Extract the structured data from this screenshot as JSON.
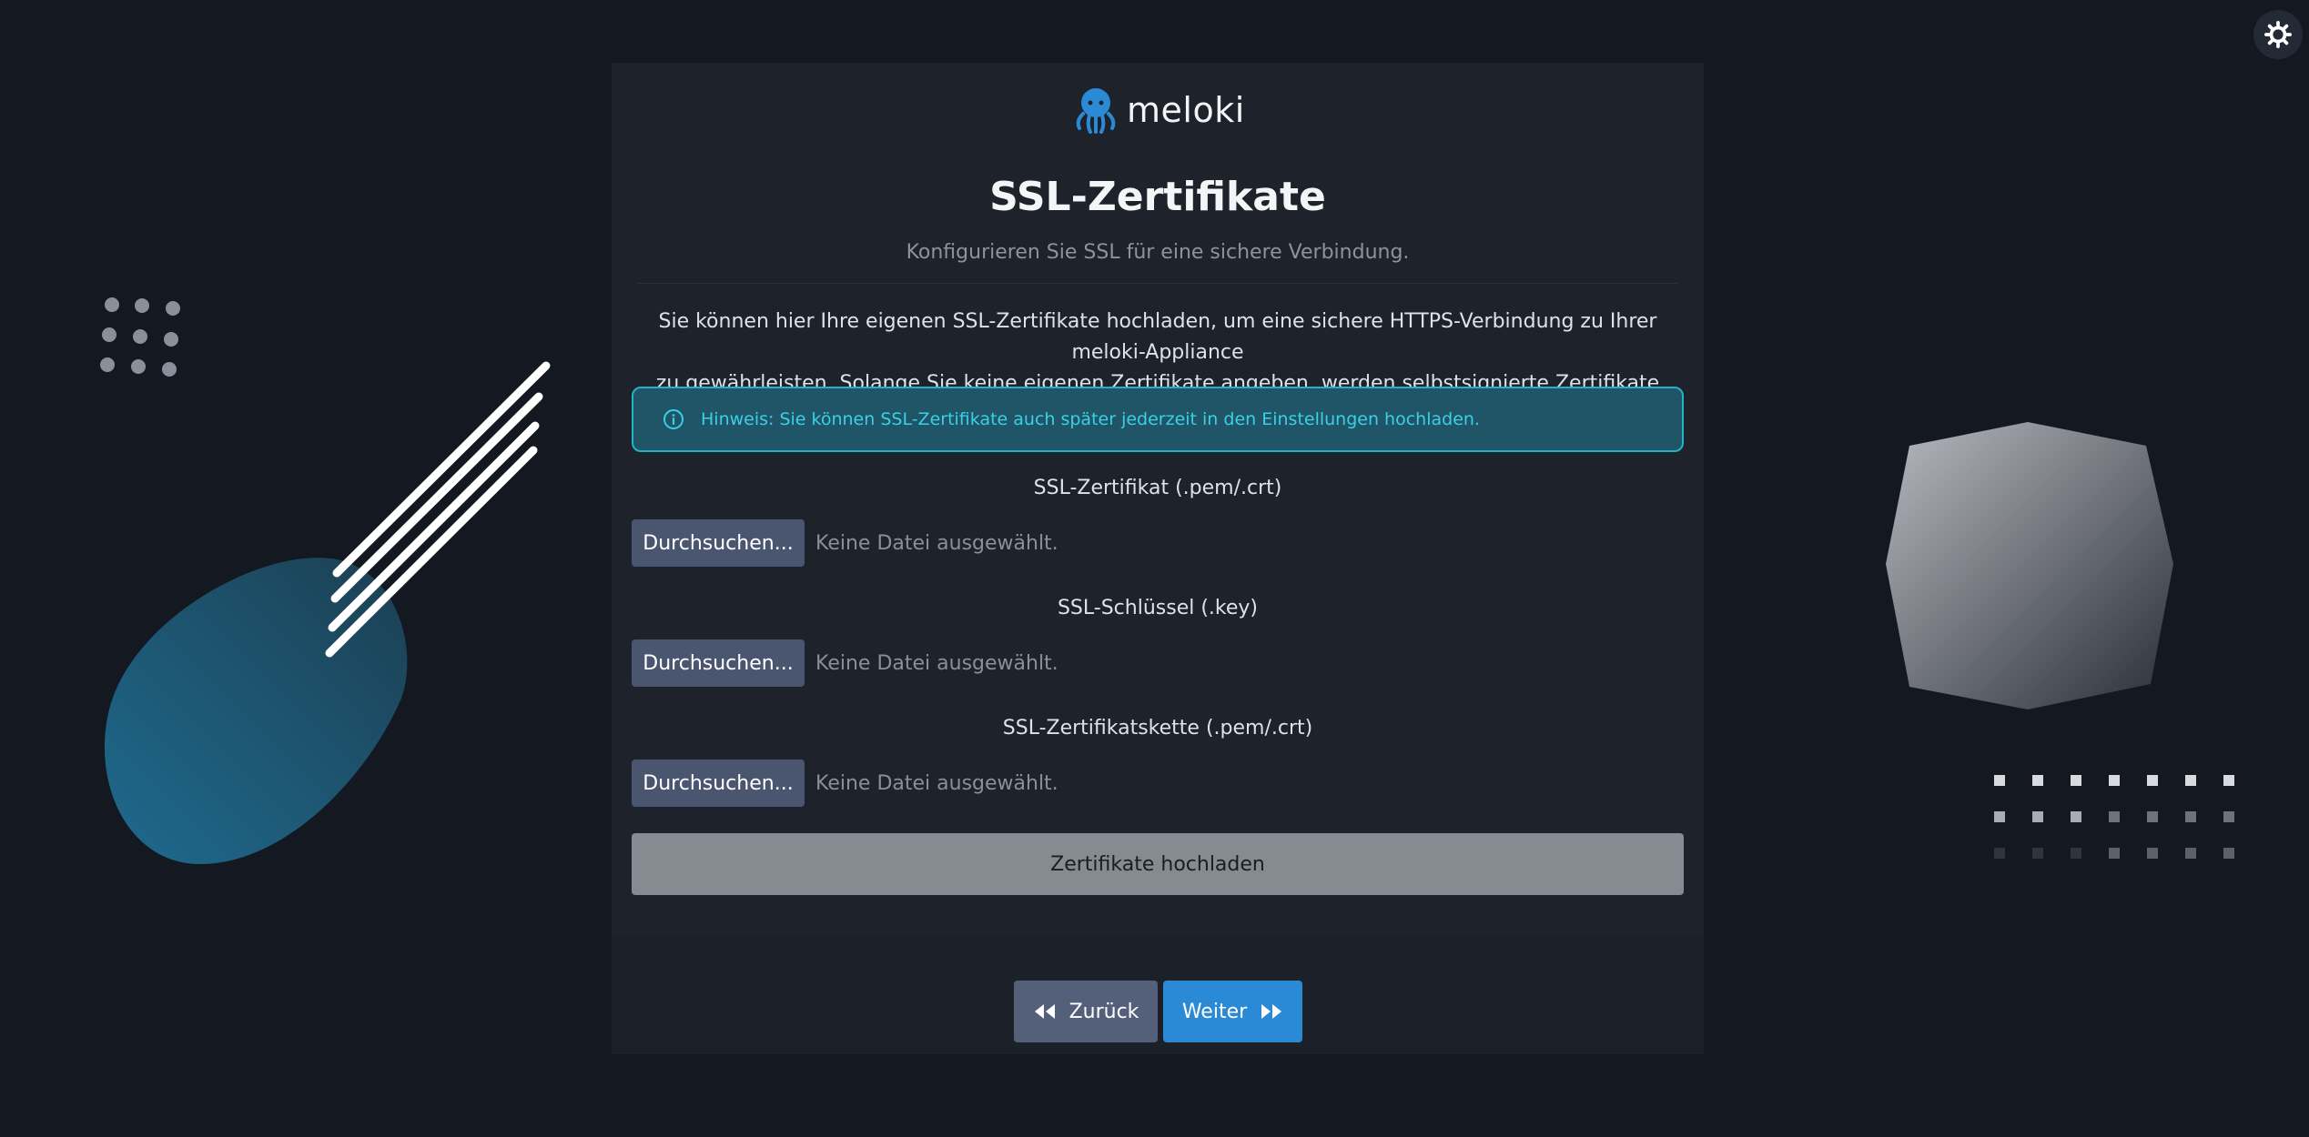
{
  "header": {
    "theme_toggle_icon": "gear-icon",
    "logo_text": "meloki",
    "logo_icon": "octopus-icon",
    "brand_color": "#2b8ad6"
  },
  "page": {
    "title": "SSL-Zertifikate",
    "subtitle": "Konfigurieren Sie SSL für eine sichere Verbindung.",
    "intro_line1": "Sie können hier Ihre eigenen SSL-Zertifikate hochladen, um eine sichere HTTPS-Verbindung zu Ihrer meloki-Appliance",
    "intro_line2": "zu gewährleisten. Solange Sie keine eigenen Zertifikate angeben, werden selbstsignierte Zertifikate verwendet."
  },
  "alert": {
    "icon": "info-icon",
    "text": "Hinweis: Sie können SSL-Zertifikate auch später jederzeit in den Einstellungen hochladen.",
    "color": "#3ad0e6"
  },
  "fields": [
    {
      "label": "SSL-Zertifikat (.pem/.crt)",
      "button": "Durchsuchen...",
      "status": "Keine Datei ausgewählt."
    },
    {
      "label": "SSL-Schlüssel (.key)",
      "button": "Durchsuchen...",
      "status": "Keine Datei ausgewählt."
    },
    {
      "label": "SSL-Zertifikatskette (.pem/.crt)",
      "button": "Durchsuchen...",
      "status": "Keine Datei ausgewählt."
    }
  ],
  "upload_button": "Zertifikate hochladen",
  "nav": {
    "back_label": "Zurück",
    "back_icon": "double-chevron-left-icon",
    "next_label": "Weiter",
    "next_icon": "double-chevron-right-icon"
  }
}
